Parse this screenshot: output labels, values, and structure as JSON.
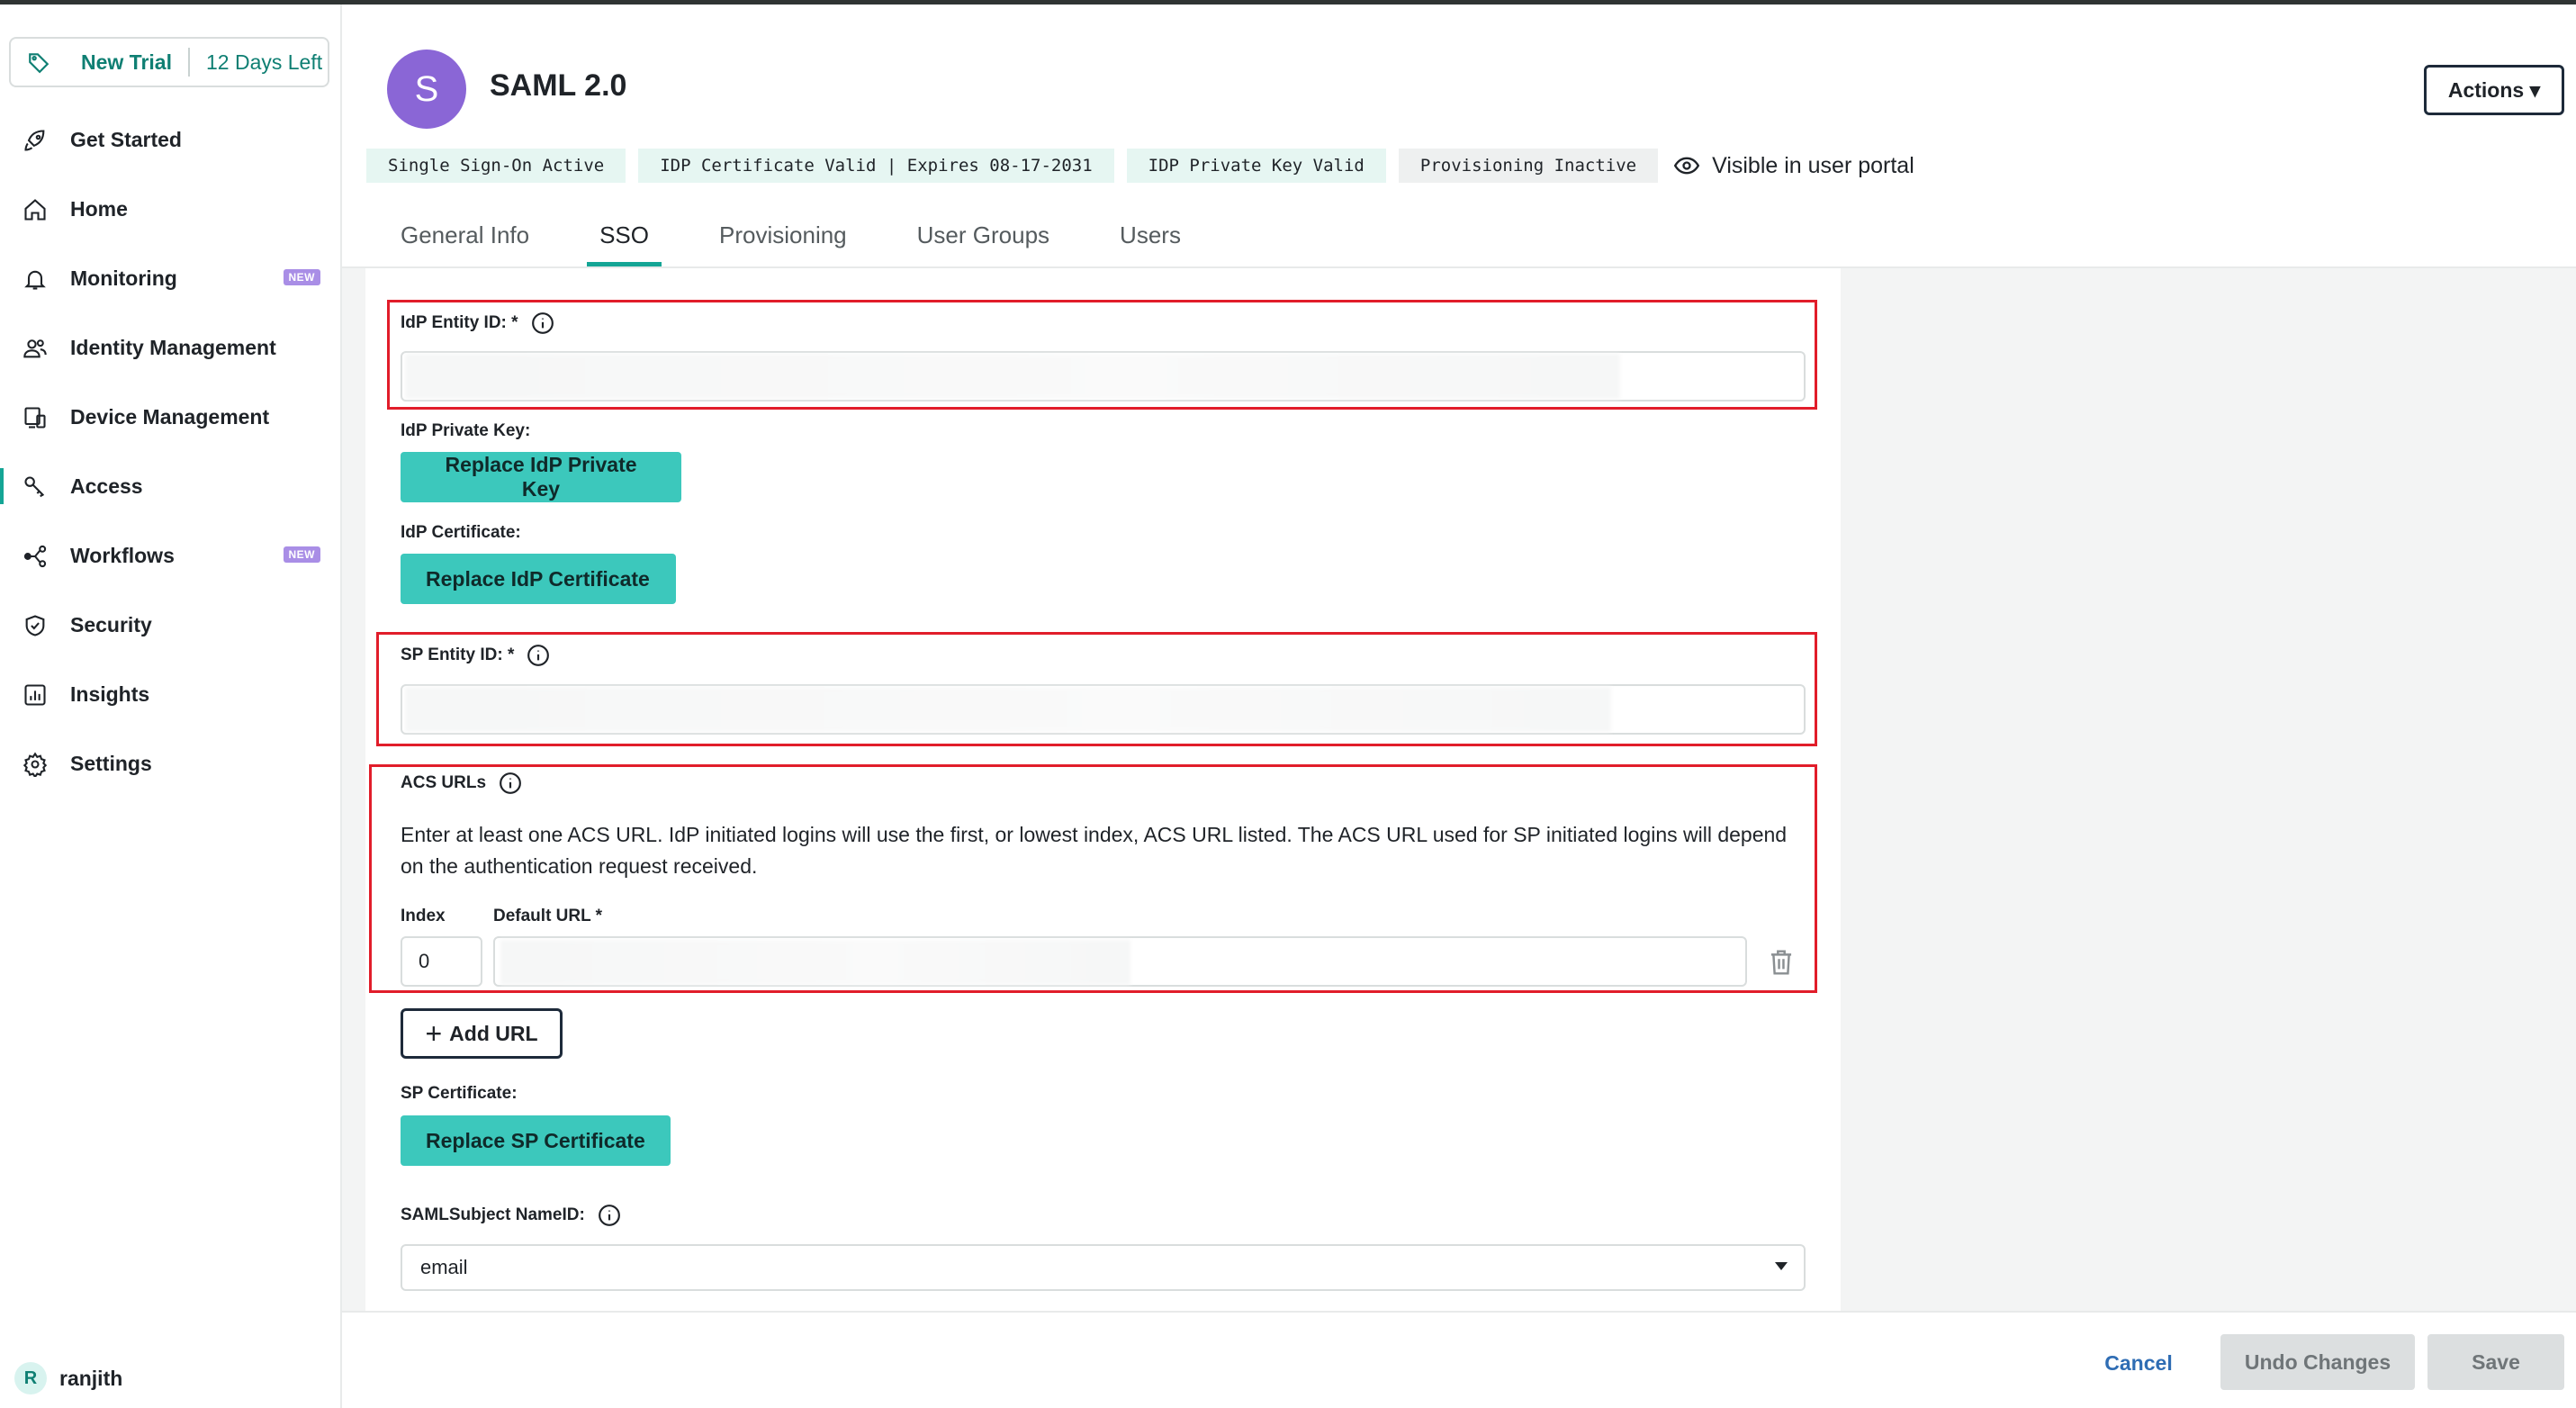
{
  "trial": {
    "label": "New Trial",
    "days_left": "12 Days Left"
  },
  "sidebar": {
    "items": [
      {
        "label": "Get Started",
        "icon": "rocket-icon"
      },
      {
        "label": "Home",
        "icon": "home-icon"
      },
      {
        "label": "Monitoring",
        "icon": "bell-icon",
        "badge": "NEW"
      },
      {
        "label": "Identity Management",
        "icon": "users-icon"
      },
      {
        "label": "Device Management",
        "icon": "devices-icon"
      },
      {
        "label": "Access",
        "icon": "key-icon",
        "active": true
      },
      {
        "label": "Workflows",
        "icon": "workflow-icon",
        "badge": "NEW"
      },
      {
        "label": "Security",
        "icon": "shield-icon"
      },
      {
        "label": "Insights",
        "icon": "chart-icon"
      },
      {
        "label": "Settings",
        "icon": "gear-icon"
      }
    ],
    "user": {
      "initial": "R",
      "name": "ranjith"
    }
  },
  "header": {
    "avatar_letter": "S",
    "title": "SAML 2.0",
    "actions_label": "Actions ▾",
    "statuses": [
      "Single Sign-On Active",
      "IDP Certificate Valid | Expires 08-17-2031",
      "IDP Private Key Valid",
      "Provisioning Inactive"
    ],
    "visible_label": "Visible in user portal"
  },
  "tabs": [
    "General Info",
    "SSO",
    "Provisioning",
    "User Groups",
    "Users"
  ],
  "active_tab": "SSO",
  "form": {
    "idp_entity_id_label": "IdP Entity ID: *",
    "idp_private_key_label": "IdP Private Key:",
    "replace_idp_private_key": "Replace IdP Private Key",
    "idp_certificate_label": "IdP Certificate:",
    "replace_idp_certificate": "Replace IdP Certificate",
    "sp_entity_id_label": "SP Entity ID: *",
    "acs_urls_label": "ACS URLs",
    "acs_description": "Enter at least one ACS URL. IdP initiated logins will use the first, or lowest index, ACS URL listed. The ACS URL used for SP initiated logins will depend on the authentication request received.",
    "index_label": "Index",
    "default_url_label": "Default URL *",
    "index_value": "0",
    "add_url_label": "Add URL",
    "sp_certificate_label": "SP Certificate:",
    "replace_sp_certificate": "Replace SP Certificate",
    "nameid_label": "SAMLSubject NameID:",
    "nameid_value": "email"
  },
  "footer": {
    "cancel": "Cancel",
    "undo": "Undo Changes",
    "save": "Save"
  },
  "colors": {
    "accent": "#14a595",
    "teal_button": "#3cc8bc",
    "highlight": "#e11d2a",
    "avatar": "#8a66d6"
  }
}
